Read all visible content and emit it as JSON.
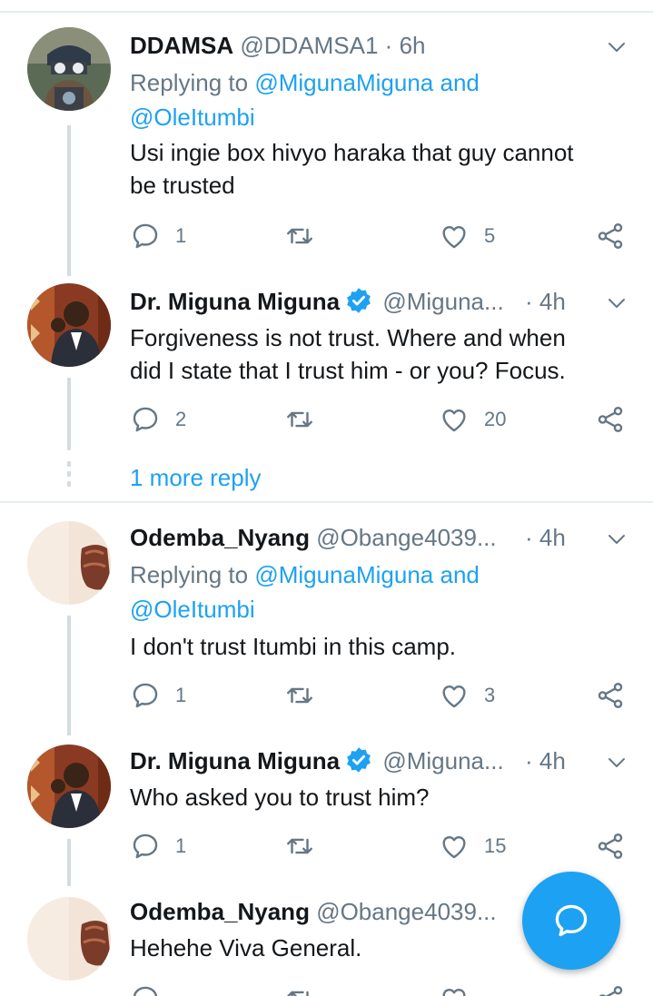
{
  "colors": {
    "accent": "#1da1f2",
    "muted": "#657786",
    "thread_line": "#d4dce2"
  },
  "tweets": [
    {
      "name": "DDAMSA",
      "handle": "@DDAMSA1",
      "time": "6h",
      "replying_prefix": "Replying to ",
      "replying_mentions": "@MigunaMiguna and",
      "replying_mentions2": "@OleItumbi",
      "text_line1": "Usi ingie box hivyo haraka that guy cannot",
      "text_line2": "be trusted",
      "replies": "1",
      "likes": "5"
    },
    {
      "name": "Dr. Miguna Miguna",
      "handle": "@Miguna...",
      "time": "4h",
      "text_line1": "Forgiveness is not trust. Where and when",
      "text_line2": "did I state that I trust him - or you? Focus.",
      "replies": "2",
      "likes": "20"
    },
    {
      "name": "Odemba_Nyang",
      "handle": "@Obange4039...",
      "time": "4h",
      "replying_prefix": "Replying to ",
      "replying_mentions": "@MigunaMiguna and",
      "replying_mentions2": "@OleItumbi",
      "text_line1": "I don't trust Itumbi in this camp.",
      "replies": "1",
      "likes": "3"
    },
    {
      "name": "Dr. Miguna Miguna",
      "handle": "@Miguna...",
      "time": "4h",
      "text_line1": "Who asked you to trust him?",
      "replies": "1",
      "likes": "15"
    },
    {
      "name": "Odemba_Nyang",
      "handle": "@Obange4039...",
      "text_line1": "Hehehe Viva General."
    }
  ],
  "more_replies": "1 more reply",
  "icons": {
    "reply": "reply-icon",
    "retweet": "retweet-icon",
    "like": "heart-icon",
    "share": "share-icon",
    "caret": "chevron-down-icon",
    "verified": "verified-badge-icon",
    "compose": "compose-reply-icon"
  }
}
